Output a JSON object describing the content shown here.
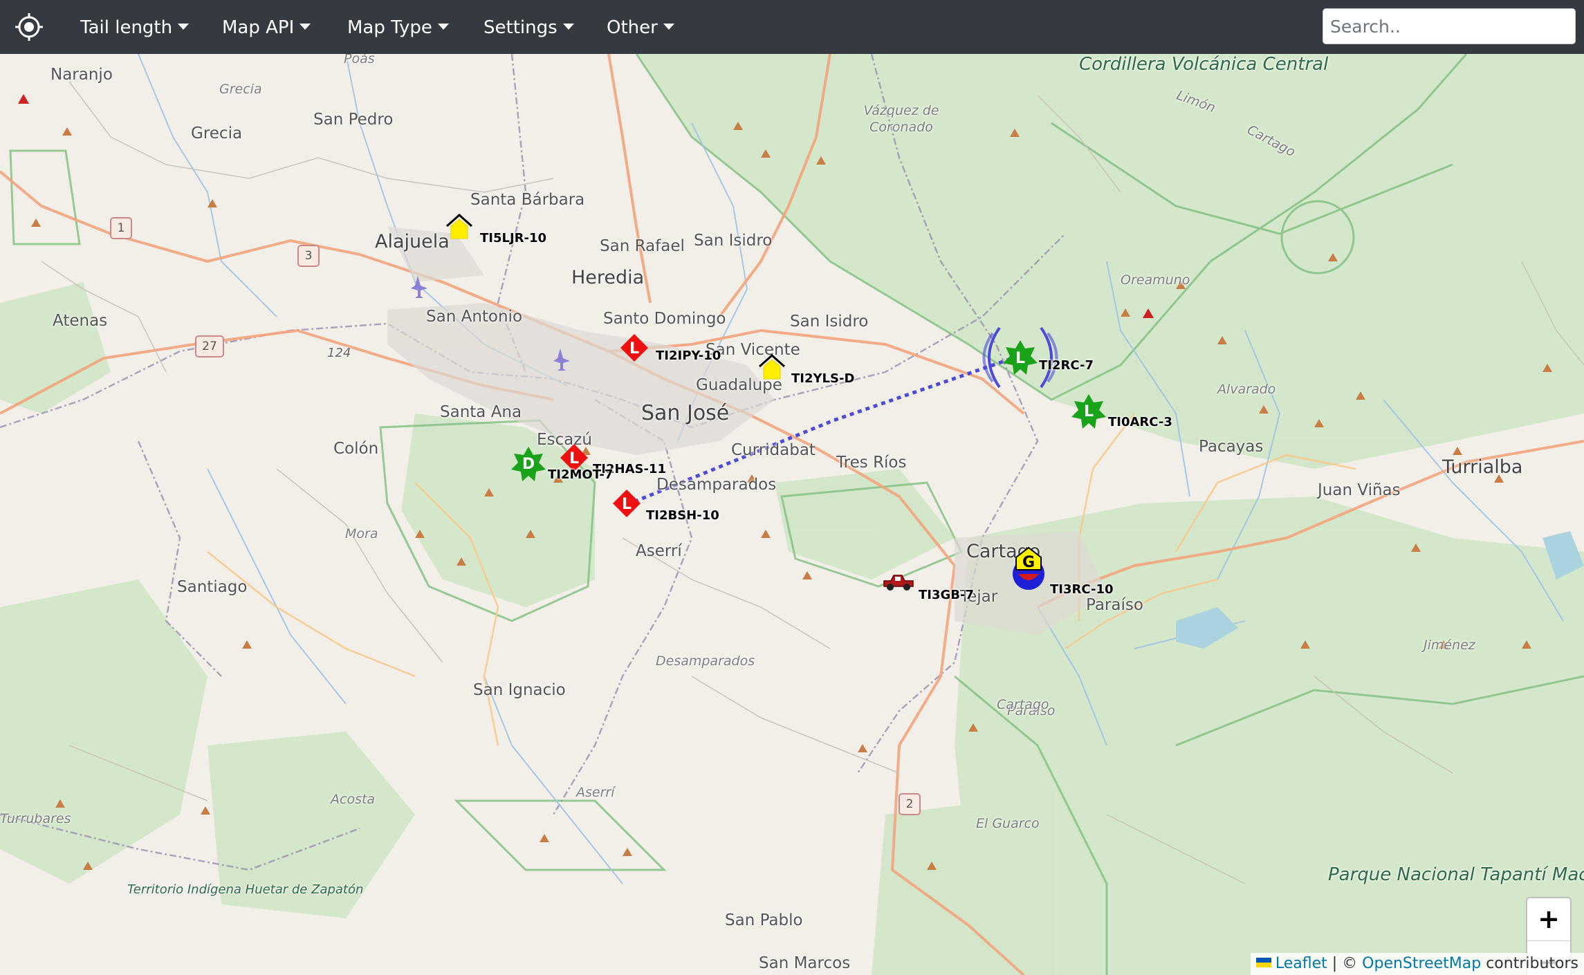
{
  "navbar": {
    "logo_icon": "crosshair-locate-icon",
    "menus": [
      {
        "label": "Tail length"
      },
      {
        "label": "Map API"
      },
      {
        "label": "Map Type"
      },
      {
        "label": "Settings"
      },
      {
        "label": "Other"
      }
    ],
    "search_placeholder": "Search.."
  },
  "map": {
    "places": [
      {
        "name": "Naranjo"
      },
      {
        "name": "Grecia"
      },
      {
        "name": "San Pedro"
      },
      {
        "name": "Santa Bárbara"
      },
      {
        "name": "Alajuela"
      },
      {
        "name": "San Rafael"
      },
      {
        "name": "San Isidro"
      },
      {
        "name": "Heredia"
      },
      {
        "name": "Atenas"
      },
      {
        "name": "San Antonio"
      },
      {
        "name": "Santo Domingo"
      },
      {
        "name": "San Isidro"
      },
      {
        "name": "San Vicente"
      },
      {
        "name": "Guadalupe"
      },
      {
        "name": "San José"
      },
      {
        "name": "Santa Ana"
      },
      {
        "name": "Escazú"
      },
      {
        "name": "Colón"
      },
      {
        "name": "Curridabat"
      },
      {
        "name": "Tres Ríos"
      },
      {
        "name": "Desamparados"
      },
      {
        "name": "Aserrí"
      },
      {
        "name": "Pacayas"
      },
      {
        "name": "Turrialba"
      },
      {
        "name": "Juan Viñas"
      },
      {
        "name": "Cartago"
      },
      {
        "name": "Paraíso"
      },
      {
        "name": "Santiago"
      },
      {
        "name": "San Ignacio"
      },
      {
        "name": "San Pablo"
      },
      {
        "name": "San Marcos"
      },
      {
        "name": "Oreamuno"
      },
      {
        "name": "Alvarado"
      },
      {
        "name": "Jiménez"
      },
      {
        "name": "El Guarco"
      },
      {
        "name": "Paraíso"
      },
      {
        "name": "Acosta"
      },
      {
        "name": "Aserrí"
      },
      {
        "name": "Desamparados"
      },
      {
        "name": "Mora"
      },
      {
        "name": "Poás"
      },
      {
        "name": "Grecia"
      },
      {
        "name": "Vázquez de Coronado"
      },
      {
        "name": "Limón"
      },
      {
        "name": "Cartago"
      },
      {
        "name": "Cartago"
      },
      {
        "name": "Turrubares"
      },
      {
        "name": "Tejar"
      },
      {
        "name": "Cordillera Volcánica Central"
      },
      {
        "name": "Parque Nacional Tapantí Macizo Cerro de la Muerte"
      },
      {
        "name": "Territorio Indígena Huetar de Zapatón"
      }
    ],
    "road_shields": [
      {
        "number": "1"
      },
      {
        "number": "3"
      },
      {
        "number": "27"
      },
      {
        "number": "2"
      }
    ],
    "road_numbers": [
      {
        "number": "124"
      }
    ],
    "stations": [
      {
        "callsign": "TI5LJR-10",
        "icon": "home-icon"
      },
      {
        "callsign": "TI2IPY-10",
        "icon": "red-diamond-l-icon"
      },
      {
        "callsign": "TI2YLS-D",
        "icon": "home-icon"
      },
      {
        "callsign": "TI2RC-7",
        "icon": "green-star-l-icon"
      },
      {
        "callsign": "TI0ARC-3",
        "icon": "green-star-l-icon"
      },
      {
        "callsign": "TI2HAS-11",
        "icon": "red-diamond-l-icon"
      },
      {
        "callsign": "TI2MOT-7",
        "icon": "green-star-d-icon"
      },
      {
        "callsign": "TI2BSH-10",
        "icon": "red-diamond-l-icon"
      },
      {
        "callsign": "TI3GB-7",
        "icon": "car-icon"
      },
      {
        "callsign": "TI3RC-10",
        "icon": "gateway-g-icon"
      }
    ],
    "path_color": "#4b4bd8"
  },
  "zoom": {
    "in_label": "+",
    "out_label": "−"
  },
  "attribution": {
    "leaflet": "Leaflet",
    "separator": " | © ",
    "osm": "OpenStreetMap",
    "suffix": " contributors"
  }
}
